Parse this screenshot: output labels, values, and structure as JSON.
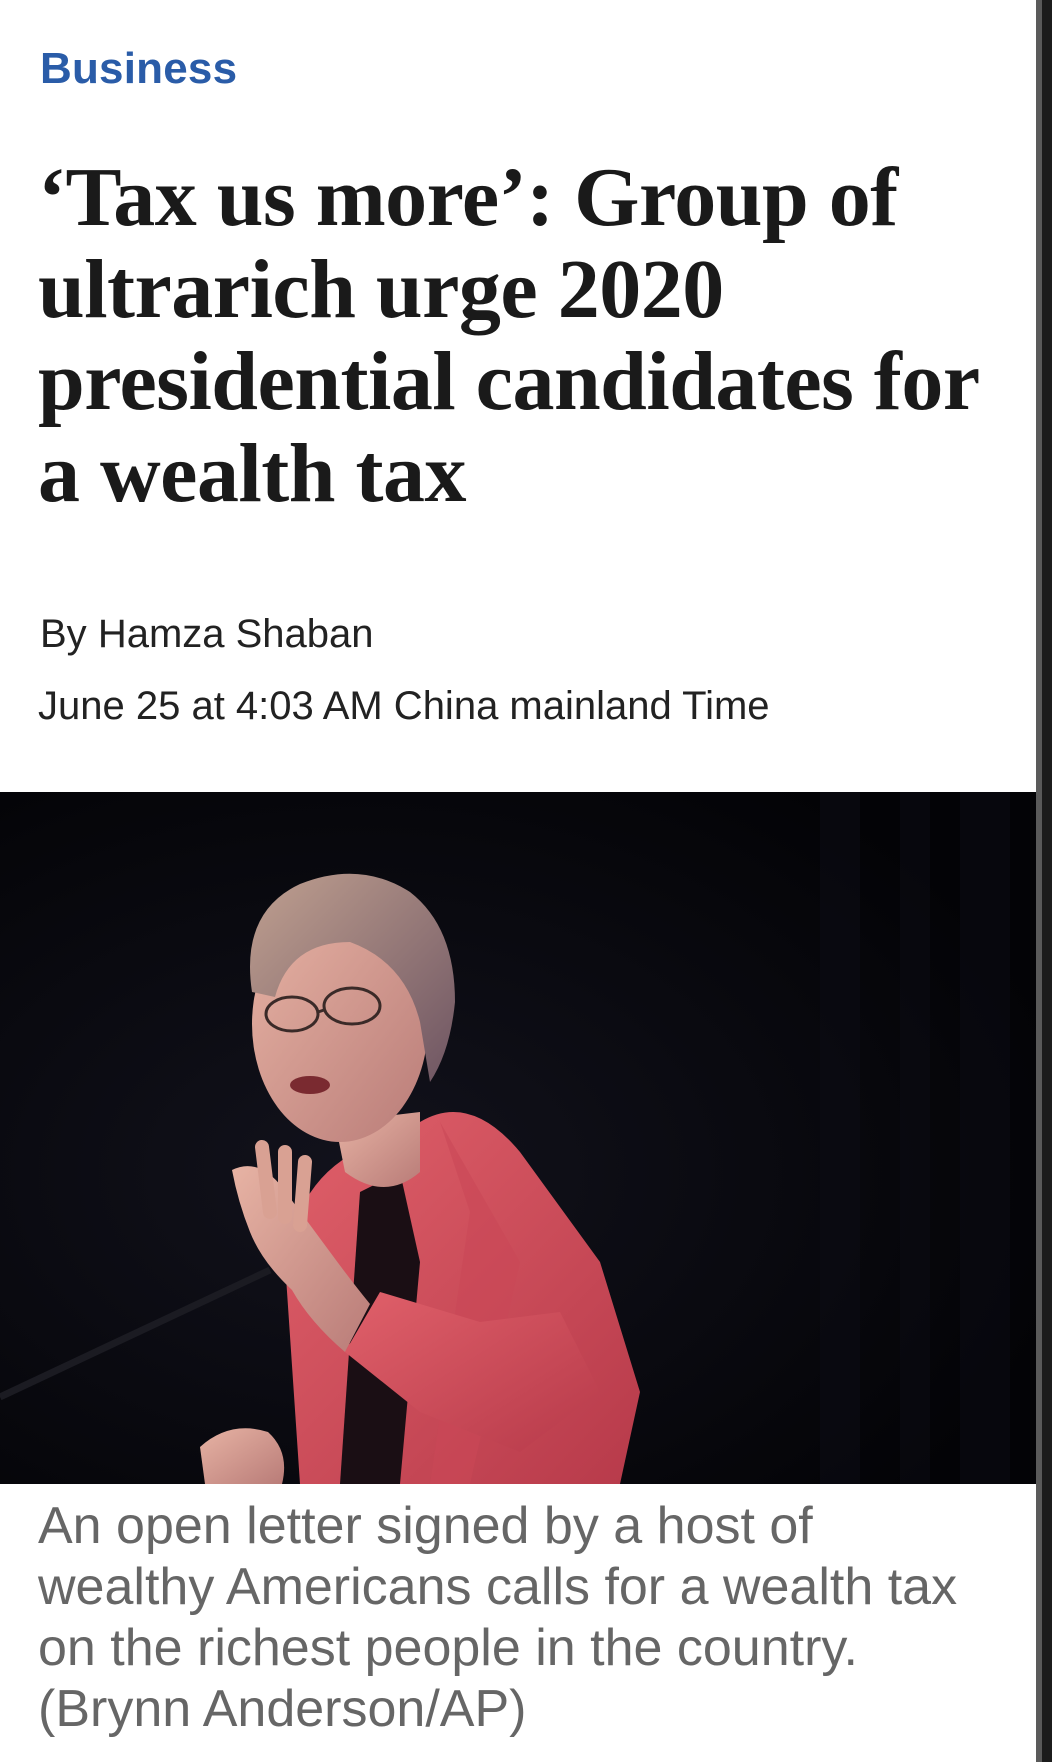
{
  "article": {
    "section": "Business",
    "headline": "‘Tax us more’: Group of ultrarich urge 2020 presidential candidates for a wealth tax",
    "byline_prefix": "By",
    "author": "Hamza Shaban",
    "timestamp": "June 25 at 4:03 AM China mainland Time"
  },
  "photo": {
    "subject": "speaker-at-podium-photo",
    "caption": "An open letter signed by a host of wealthy Americans calls for a wealth tax on the richest people in the country. (Brynn Anderson/AP)"
  },
  "colors": {
    "section_label": "#2a5ca8",
    "headline": "#1a1a1a",
    "caption": "#666666",
    "photo_background": "#050509"
  }
}
